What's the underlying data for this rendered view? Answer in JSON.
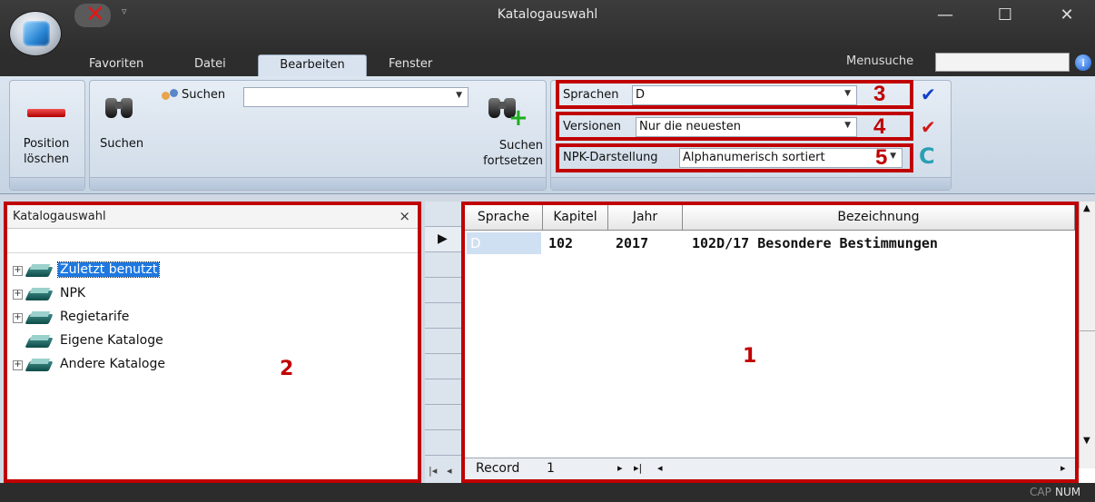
{
  "window": {
    "title": "Katalogauswahl",
    "controls": {
      "minimize": "—",
      "maximize": "☐",
      "close": "✕"
    }
  },
  "menu": {
    "tabs": [
      "Favoriten",
      "Datei",
      "Bearbeiten",
      "Fenster"
    ],
    "active_tab": "Bearbeiten",
    "search_label": "Menusuche",
    "search_value": ""
  },
  "ribbon": {
    "position_delete": {
      "line1": "Position",
      "line2": "löschen"
    },
    "search": {
      "label": "Suchen",
      "field_label": "Suchen",
      "field_value": ""
    },
    "search_next": {
      "line1": "Suchen",
      "line2": "fortsetzen"
    },
    "filters": [
      {
        "label": "Sprachen",
        "value": "D",
        "marker": "3"
      },
      {
        "label": "Versionen",
        "value": "Nur die neuesten",
        "marker": "4"
      },
      {
        "label": "NPK-Darstellung",
        "value": "Alphanumerisch sortiert",
        "marker": "5"
      }
    ]
  },
  "left_panel": {
    "title": "Katalogauswahl",
    "close": "×",
    "marker": "2",
    "tree": [
      {
        "label": "Zuletzt benutzt",
        "expandable": true,
        "selected": true
      },
      {
        "label": "NPK",
        "expandable": true,
        "selected": false
      },
      {
        "label": "Regietarife",
        "expandable": true,
        "selected": false
      },
      {
        "label": "Eigene Kataloge",
        "expandable": false,
        "selected": false
      },
      {
        "label": "Andere Kataloge",
        "expandable": true,
        "selected": false
      }
    ]
  },
  "grid": {
    "marker": "1",
    "columns": [
      "Sprache",
      "Kapitel",
      "Jahr",
      "Bezeichnung"
    ],
    "rows": [
      {
        "sprache": "D",
        "kapitel": "102",
        "jahr": "2017",
        "bezeichnung": "102D/17 Besondere Bestimmungen"
      }
    ],
    "nav": {
      "record_label": "Record",
      "record_value": "1"
    }
  },
  "status": {
    "cap": "CAP",
    "num": "NUM"
  },
  "colors": {
    "annotation_red": "#c00000",
    "selection_blue": "#1e78e0",
    "check_blue": "#1040c8",
    "check_red": "#d01818"
  }
}
